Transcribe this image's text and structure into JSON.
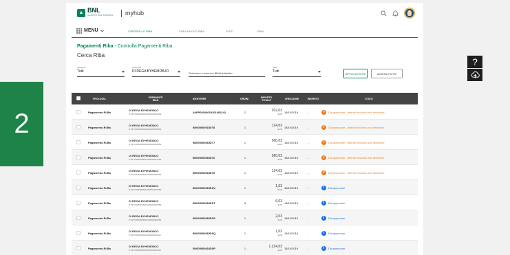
{
  "header": {
    "brand": "BNL",
    "brand_sub": "GRUPPO BNP PARIBAS",
    "app_name": "myhub"
  },
  "nav": {
    "menu_label": "MENU",
    "tabs": [
      {
        "label": "CONTROLLO RIBA",
        "active": true
      },
      {
        "label": "CREA NUOVO RIBA",
        "active": false
      },
      {
        "label": "ESITI",
        "active": false
      },
      {
        "label": "RIBA",
        "active": false
      }
    ]
  },
  "page": {
    "title_main": "Pagamenti Riba",
    "title_sep": " - ",
    "title_sub": "Controlla Pagamenti Riba",
    "section": "Cerca Riba"
  },
  "filters": {
    "type": {
      "label": "Tipologia",
      "value": "Tutti"
    },
    "ordering": {
      "label": "Ordinante",
      "value": "DI REGA BYHEMOBJO"
    },
    "iban": {
      "placeholder": "Seleziona o inserisci IBAN Addebito"
    },
    "status": {
      "label": "Stato",
      "value": "Tutti"
    },
    "apply_label": "APPLICA FILTRI",
    "reset_label": "AZZERA FILTRI"
  },
  "table": {
    "columns": {
      "type": "TIPOLOGIA",
      "ordering_1": "ORDINANTE",
      "ordering_2": "IBAN",
      "id": "IDENTIFIER",
      "orders": "ORDINI",
      "amount_1": "IMPORTO",
      "amount_2": "TOTALE",
      "created": "CREAZIONE",
      "inserted": "INSERITO",
      "status": "STATO"
    },
    "rows": [
      {
        "type": "Pagamento Ri.Ba",
        "name": "DI REGA BYHEMOBJO",
        "iban": "IT62Y0306909606100000002256",
        "id": "A4FP00100019101002242",
        "orders": "2",
        "amount": "202,03",
        "currency": "EUR",
        "date": "18/10/2019",
        "inserted": "-",
        "status": "Da approvare - attendi invocato una decisione",
        "status_kind": "warn"
      },
      {
        "type": "Pagamento Ri.Ba",
        "name": "DI REGA BYHEMOBJO",
        "iban": "IT32Y0306909606100000000256",
        "id": "B00050000DIDT8",
        "orders": "1",
        "amount": "124,03",
        "currency": "EUR",
        "date": "18/10/2019",
        "inserted": "-",
        "status": "Da approvare - attendi invocato una decisione",
        "status_kind": "warn"
      },
      {
        "type": "Pagamento Ri.Ba",
        "name": "DI REGA BYHEMOBJO",
        "iban": "IT32Y0306909606100000000256",
        "id": "B00050000DIDT7",
        "orders": "1",
        "amount": "560,03",
        "currency": "EUR",
        "date": "18/10/2019",
        "inserted": "-",
        "status": "Da approvare - attendi invocato una decisione",
        "status_kind": "warn"
      },
      {
        "type": "Pagamento Ri.Ba",
        "name": "DI REGA BYHEMOBJO",
        "iban": "IT32Y0306909606100000001256",
        "id": "B00050000DIDT6",
        "orders": "1",
        "amount": "560,03",
        "currency": "EUR",
        "date": "18/10/2019",
        "inserted": "-",
        "status": "Da approvare - attendi invocato una decisione",
        "status_kind": "warn"
      },
      {
        "type": "Pagamento Ri.Ba",
        "name": "DI REGA BYHEMOBJO",
        "iban": "IT32Y0306909606100000000256",
        "id": "B00050000DIDT5",
        "orders": "1",
        "amount": "124,03",
        "currency": "EUR",
        "date": "18/10/2019",
        "inserted": "-",
        "status": "Da approvare - attendi invocato una decisione",
        "status_kind": "warn"
      },
      {
        "type": "Pagamento Ri.Ba",
        "name": "DI REGA BYHEMOBJO",
        "iban": "IT32Y0306909606100000000256",
        "id": "B00050000DIDSV",
        "orders": "1",
        "amount": "1,03",
        "currency": "EUR",
        "date": "18/10/2019",
        "inserted": "-",
        "status": "Da approvare",
        "status_kind": "info"
      },
      {
        "type": "Pagamento Ri.Ba",
        "name": "DI REGA BYHEMOBJO",
        "iban": "IT32Y0306909606100000000256",
        "id": "B00050000DIDST",
        "orders": "3",
        "amount": "6,03",
        "currency": "EUR",
        "date": "18/10/2019",
        "inserted": "-",
        "status": "Da approvare",
        "status_kind": "info"
      },
      {
        "type": "Pagamento Ri.Ba",
        "name": "DI REGA BYHEMOBJO",
        "iban": "IT32Y0306909606100000000256",
        "id": "B00050000DIDSS",
        "orders": "1",
        "amount": "2,03",
        "currency": "EUR",
        "date": "18/10/2019",
        "inserted": "-",
        "status": "Da approvare",
        "status_kind": "info"
      },
      {
        "type": "Pagamento Ri.Ba",
        "name": "DI REGA BYHEMOBJO",
        "iban": "IT32Y0306909606100000002111",
        "id": "B00050000DIDSQ",
        "orders": "1",
        "amount": "1,03",
        "currency": "EUR",
        "date": "18/10/2019",
        "inserted": "-",
        "status": "Da approvare",
        "status_kind": "info"
      },
      {
        "type": "Pagamento Ri.Ba",
        "name": "DI REGA BYHEMOBJO",
        "iban": "IT32Y0306909606100000002111",
        "id": "B00050000DIDSP",
        "orders": "1",
        "amount": "1.234,03",
        "currency": "EUR",
        "date": "18/10/2019",
        "inserted": "-",
        "status": "Da approvare",
        "status_kind": "info"
      }
    ]
  },
  "overlay": {
    "step_number": "2",
    "help_glyph": "?"
  },
  "colors": {
    "brand_green": "#00845a",
    "badge_green": "#1e8347",
    "warn": "#ef7d1f",
    "info": "#1a73e8",
    "header_dark": "#444444"
  },
  "icons": [
    "search-icon",
    "bell-icon",
    "avatar",
    "grid-icon",
    "chevron-down-icon",
    "help-icon",
    "cloud-upload-icon"
  ]
}
